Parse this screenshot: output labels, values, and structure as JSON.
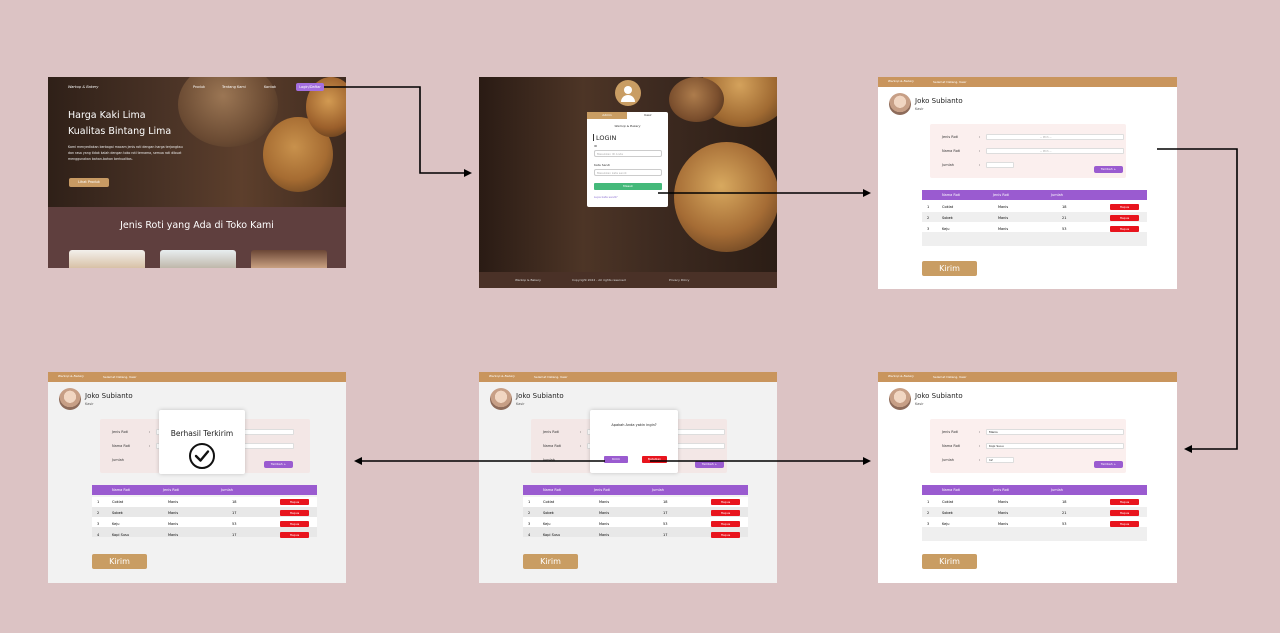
{
  "frame1": {
    "logo": "Warkop & Bakery",
    "nav": [
      "Produk",
      "Tentang Kami",
      "Kontak"
    ],
    "nav_button": "Login/Daftar",
    "hero_title_1": "Harga Kaki Lima",
    "hero_title_2": "Kualitas Bintang Lima",
    "hero_desc_1": "Kami menyediakan berbagai macam jenis roti dengan harga terjangkau",
    "hero_desc_2": "dan rasa yang tidak kalah dengan toko roti ternama, semua roti dibuat",
    "hero_desc_3": "menggunakan bahan-bahan berkualitas.",
    "hero_button": "Lihat Produk",
    "section_title": "Jenis Roti yang Ada di Toko Kami"
  },
  "frame2": {
    "tab_left": "Admin",
    "tab_right": "Kasir",
    "logo": "Warkop & Bakery",
    "title": "LOGIN",
    "label_id": "ID",
    "placeholder_id": "Masukkan ID Anda",
    "label_pass": "Kata Sandi",
    "placeholder_pass": "Masukkan kata sandi",
    "button": "Masuk",
    "forgot": "Lupa kata sandi?",
    "footer_1": "Warkop & Bakery",
    "footer_2": "Copyright 2022 - All rights reserved",
    "footer_3": "Privacy Policy"
  },
  "dash": {
    "topbar": "Selamat Datang, Kasir",
    "name": "Joko Subianto",
    "role": "Kasir",
    "label_jenis": "Jenis Roti",
    "label_nama": "Nama Roti",
    "label_jumlah": "Jumlah",
    "colon": ":",
    "placeholder_select": "-- Pilih --",
    "tambah": "Tambah +",
    "col_nama": "Nama Roti",
    "col_jenis": "Jenis Roti",
    "col_jumlah": "Jumlah",
    "hapus": "Hapus",
    "kirim": "Kirim"
  },
  "rows_3": [
    {
      "no": "1",
      "nama": "Coklat",
      "jenis": "Manis",
      "jumlah": "18"
    },
    {
      "no": "2",
      "nama": "Sobek",
      "jenis": "Manis",
      "jumlah": "21"
    },
    {
      "no": "3",
      "nama": "Keju",
      "jenis": "Manis",
      "jumlah": "53"
    }
  ],
  "rows_4": [
    {
      "no": "1",
      "nama": "Coklat",
      "jenis": "Manis",
      "jumlah": "18"
    },
    {
      "no": "2",
      "nama": "Sobek",
      "jenis": "Manis",
      "jumlah": "17"
    },
    {
      "no": "3",
      "nama": "Keju",
      "jenis": "Manis",
      "jumlah": "53"
    },
    {
      "no": "4",
      "nama": "Kopi Susu",
      "jenis": "Manis",
      "jumlah": "17"
    }
  ],
  "filled": {
    "jenis": "Manis",
    "nama": "Kopi Susu",
    "jumlah": "12"
  },
  "confirm": {
    "question": "Apakah Anda yakin ingin?",
    "ok": "Kirim",
    "cancel": "Batalkan"
  },
  "success": {
    "title": "Berhasil Terkirim"
  }
}
